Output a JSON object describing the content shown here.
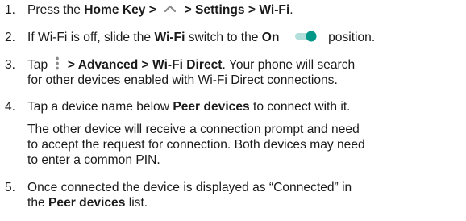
{
  "steps": [
    {
      "num": "1.",
      "t1": "Press the ",
      "b1": "Home Key >",
      "icon": "up-caret-icon",
      "b2": "> Settings > Wi-Fi",
      "t2": "."
    },
    {
      "num": "2.",
      "t1": "If Wi-Fi is off, slide the ",
      "b1": "Wi-Fi",
      "t2": " switch to the ",
      "b2": "On",
      "icon": "toggle-switch-on-icon",
      "t3": "position."
    },
    {
      "num": "3.",
      "t1": "Tap ",
      "icon": "more-options-icon",
      "b1": "> Advanced > Wi-Fi Direct",
      "t2": ". Your phone will search",
      "line2": "for other devices enabled with Wi-Fi Direct connections."
    },
    {
      "num": "4.",
      "t1": "Tap a device name below ",
      "b1": "Peer devices",
      "t2": " to connect with it.",
      "note_lines": [
        "The other device will receive a connection prompt and need",
        "to accept the request for connection. Both devices may need",
        "to enter a common PIN."
      ]
    },
    {
      "num": "5.",
      "line1": "Once connected the device is displayed as “Connected” in",
      "t1": "the ",
      "b1": "Peer devices",
      "t2": " list."
    }
  ],
  "colors": {
    "text": "#1a1a1a",
    "icon_gray": "#8a8a8a",
    "toggle_track": "#b2dfdb",
    "toggle_thumb": "#009688"
  }
}
